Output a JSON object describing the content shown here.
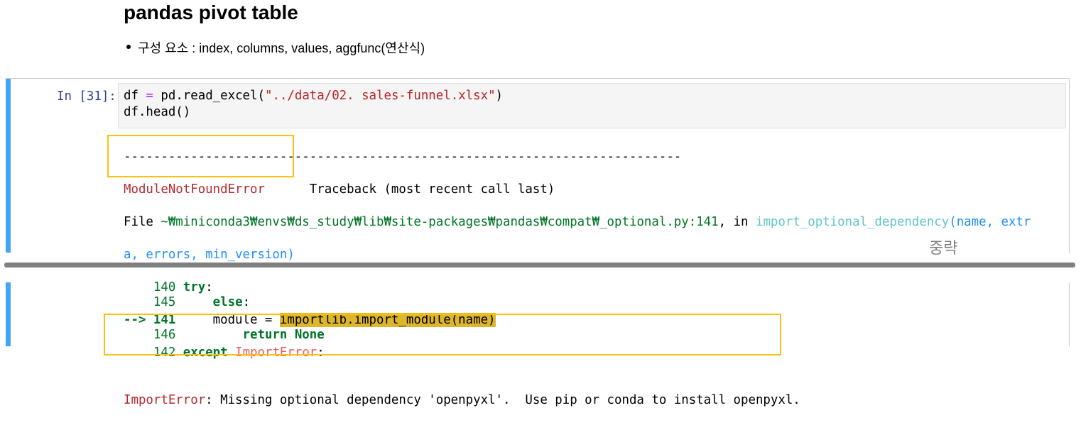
{
  "heading": "pandas pivot table",
  "bullet": "구성 요소 : index, columns, values, aggfunc(연산식)",
  "cell": {
    "prompt": "In [31]:",
    "code": [
      {
        "a": "df ",
        "op": "=",
        "b": " pd.read_excel(",
        "s": "\"../data/02. sales-funnel.xlsx\"",
        "c": ")"
      },
      {
        "a": "df.head()"
      }
    ],
    "trace": {
      "dashes": "---------------------------------------------------------------------------",
      "error_name": "ModuleNotFoundError",
      "traceback_label": "Traceback (most recent call last)",
      "file_prefix": "File ",
      "file_path": "~₩miniconda3₩envs₩ds_study₩lib₩site-packages₩pandas₩compat₩_optional.py:141",
      "in_text": ", in ",
      "func": "import_optional_dependency",
      "args1": "(name, extr",
      "args2": "a, errors, min_version)",
      "l140_no": "140 ",
      "l140_kw": "try",
      ":": ":",
      "l141_arrow": "--> 141",
      "l141_pre": "     module = ",
      "l141_hl": "importlib.import_module(name)",
      "l142_no": "142 ",
      "l142_kw": "except",
      "l142_err": "ImportError",
      "l145_no": "145 ",
      "l145_kw": "else",
      "l146_no": "146 ",
      "l146_kw": "return None",
      "final_err": "ImportError",
      "final_msg": ": Missing optional dependency 'openpyxl'.  Use pip or conda to install openpyxl."
    }
  },
  "omitted_label": "중략"
}
